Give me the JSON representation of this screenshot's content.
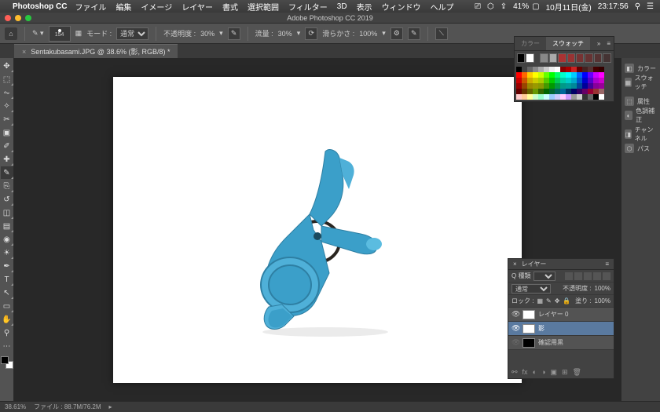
{
  "mac_menu": {
    "app_name": "Photoshop CC",
    "items": [
      "ファイル",
      "編集",
      "イメージ",
      "レイヤー",
      "書式",
      "選択範囲",
      "フィルター",
      "3D",
      "表示",
      "ウィンドウ",
      "ヘルプ"
    ],
    "battery": "41%",
    "date": "10月11日(金)",
    "time": "23:17:56"
  },
  "window_title": "Adobe Photoshop CC 2019",
  "options_bar": {
    "brush_size": "154",
    "mode_label": "モード :",
    "mode_value": "通常",
    "opacity_label": "不透明度 :",
    "opacity_value": "30%",
    "flow_label": "流量 :",
    "flow_value": "30%",
    "smoothing_label": "滑らかさ :",
    "smoothing_value": "100%"
  },
  "document_tab": {
    "title": "Sentakubasami.JPG @ 38.6% (影, RGB/8) *"
  },
  "tools": [
    "move",
    "marquee",
    "lasso",
    "wand",
    "crop",
    "frame",
    "eyedropper",
    "healing",
    "brush",
    "stamp",
    "history",
    "eraser",
    "gradient",
    "blur",
    "dodge",
    "pen",
    "type",
    "path",
    "rectangle",
    "hand",
    "zoom",
    "edit-toolbar"
  ],
  "color_panel": {
    "tab_color": "カラー",
    "tab_swatches": "スウォッチ"
  },
  "collapsed_panels": [
    "カラー",
    "スウォッチ",
    "属性",
    "色調補正",
    "チャンネル",
    "パス"
  ],
  "layers_panel": {
    "title": "レイヤー",
    "filter_label": "Q 種類",
    "blend_mode": "通常",
    "opacity_label": "不透明度 :",
    "opacity_value": "100%",
    "lock_label": "ロック :",
    "fill_label": "塗り :",
    "fill_value": "100%",
    "layers": [
      {
        "name": "レイヤー 0",
        "visible": true,
        "thumb": "white"
      },
      {
        "name": "影",
        "visible": true,
        "thumb": "white",
        "active": true
      },
      {
        "name": "確認用黒",
        "visible": false,
        "thumb": "black"
      }
    ]
  },
  "status_bar": {
    "zoom": "38.61%",
    "file_info_label": "ファイル :",
    "file_info": "88.7M/76.2M"
  },
  "swatch_colors": [
    "#000",
    "#444",
    "#666",
    "#888",
    "#aaa",
    "#ccc",
    "#eee",
    "#fff",
    "#800",
    "#a00",
    "#c22",
    "#600",
    "#422",
    "#533",
    "#400",
    "#300",
    "#f00",
    "#f60",
    "#fc0",
    "#ff0",
    "#cf0",
    "#6f0",
    "#0f0",
    "#0f6",
    "#0fc",
    "#0ff",
    "#0cf",
    "#06f",
    "#00f",
    "#60f",
    "#c0f",
    "#f0f",
    "#c00",
    "#c50",
    "#ca0",
    "#cc0",
    "#ac0",
    "#5c0",
    "#0c0",
    "#0c5",
    "#0ca",
    "#0cc",
    "#0ac",
    "#05c",
    "#00c",
    "#50c",
    "#a0c",
    "#c0c",
    "#900",
    "#940",
    "#980",
    "#990",
    "#890",
    "#490",
    "#090",
    "#094",
    "#098",
    "#099",
    "#089",
    "#049",
    "#009",
    "#409",
    "#809",
    "#909",
    "#600",
    "#630",
    "#660",
    "#690",
    "#360",
    "#060",
    "#063",
    "#066",
    "#069",
    "#036",
    "#006",
    "#306",
    "#606",
    "#903",
    "#933",
    "#966",
    "#fcc",
    "#fc9",
    "#ff9",
    "#cfc",
    "#9fc",
    "#cff",
    "#9cf",
    "#ccf",
    "#fcf",
    "#c9f",
    "#999",
    "#ccc",
    "#333",
    "#666",
    "#000",
    "#fff"
  ]
}
